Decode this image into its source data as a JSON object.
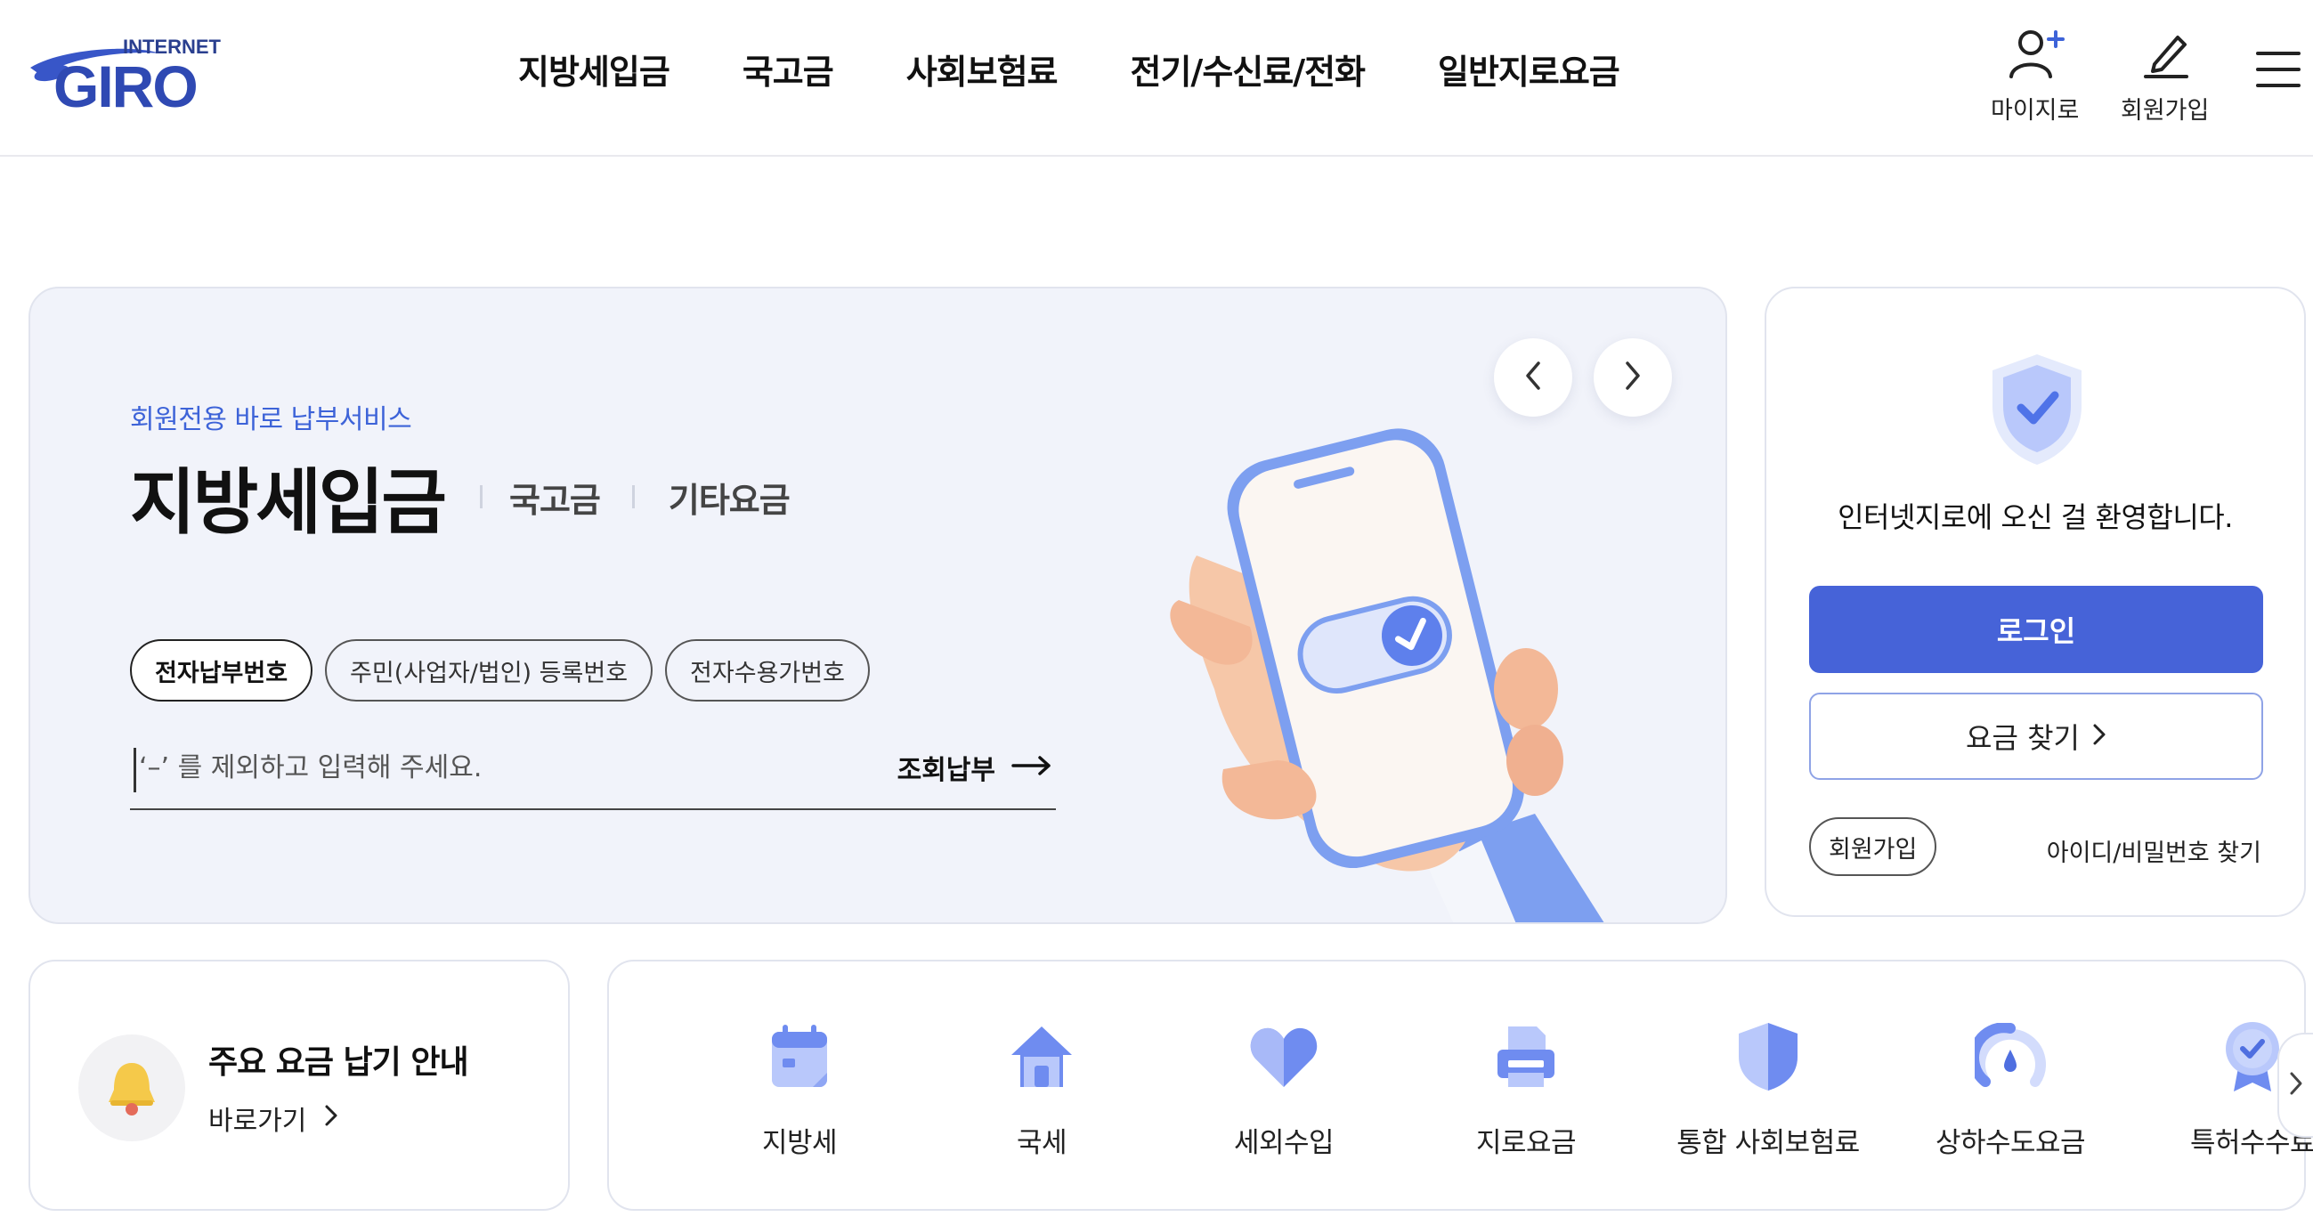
{
  "logo": {
    "small_text": "INTERNET",
    "big_text": "GIRO"
  },
  "nav": [
    {
      "label": "지방세입금"
    },
    {
      "label": "국고금"
    },
    {
      "label": "사회보험료"
    },
    {
      "label": "전기/수신료/전화"
    },
    {
      "label": "일반지로요금"
    }
  ],
  "utility": {
    "mygiro": "마이지로",
    "signup": "회원가입",
    "menu_icon": "hamburger-icon"
  },
  "hero": {
    "eyebrow": "회원전용 바로 납부서비스",
    "active_tab": "지방세입금",
    "tabs": [
      "국고금",
      "기타요금"
    ],
    "chips": [
      "전자납부번호",
      "주민(사업자/법인) 등록번호",
      "전자수용가번호"
    ],
    "search_placeholder": "‘–’ 를 제외하고 입력해 주세요.",
    "submit_label": "조회납부"
  },
  "login": {
    "welcome": "인터넷지로에 오신 걸 환영합니다.",
    "login_button": "로그인",
    "find_fee_button": "요금 찾기",
    "join_button": "회원가입",
    "find_id": "아이디/비밀번호 찾기"
  },
  "notice": {
    "title": "주요 요금 납기 안내",
    "link": "바로가기"
  },
  "quick_menu": [
    {
      "label": "지방세",
      "icon": "calendar-icon"
    },
    {
      "label": "국세",
      "icon": "house-icon"
    },
    {
      "label": "세외수입",
      "icon": "heart-icon"
    },
    {
      "label": "지로요금",
      "icon": "printer-icon"
    },
    {
      "label": "통합 사회보험료",
      "icon": "shield-icon"
    },
    {
      "label": "상하수도요금",
      "icon": "water-gauge-icon"
    },
    {
      "label": "특허수수료",
      "icon": "badge-icon"
    }
  ],
  "colors": {
    "brand_blue": "#4663d8",
    "accent_text": "#3d63d8",
    "hero_bg": "#f1f3fa",
    "icon_blue": "#6f8cf0",
    "icon_light": "#b9c8fb"
  }
}
